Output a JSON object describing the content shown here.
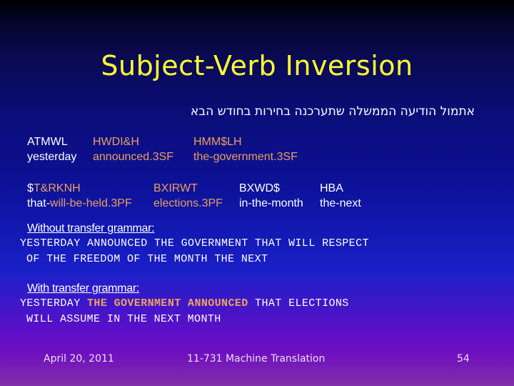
{
  "slide": {
    "title": "Subject-Verb Inversion",
    "hebrew_sentence": "אתמול הודיעה הממשלה שתערכנה בחירות בחודש הבא",
    "gloss_block_1": {
      "translit": [
        {
          "text": "ATMWL",
          "highlight": false
        },
        {
          "text": "HWDI&H",
          "highlight": true
        },
        {
          "text": "HMM$LH",
          "highlight": true
        }
      ],
      "english": [
        {
          "text": "yesterday",
          "highlight": false
        },
        {
          "text": "announced.3SF",
          "highlight": true
        },
        {
          "text": "the-government.3SF",
          "highlight": true
        }
      ]
    },
    "gloss_block_2": {
      "translit": [
        {
          "prefix": "$",
          "text": "T&RKNH",
          "highlight": true
        },
        {
          "text": "BXIRWT",
          "highlight": true
        },
        {
          "text": "BXWD$",
          "highlight": false
        },
        {
          "text": "HBA",
          "highlight": false
        }
      ],
      "english": [
        {
          "prefix": "that-",
          "text": "will-be-held.3PF",
          "highlight": true
        },
        {
          "text": "elections.3PF",
          "highlight": true
        },
        {
          "text": "in-the-month",
          "highlight": false
        },
        {
          "text": "the-next",
          "highlight": false
        }
      ]
    },
    "without_transfer": {
      "label": "Without transfer grammar:",
      "line1": "YESTERDAY ANNOUNCED THE GOVERNMENT THAT WILL RESPECT",
      "line2": "OF THE FREEDOM OF THE MONTH THE NEXT"
    },
    "with_transfer": {
      "label": "With transfer grammar:",
      "line1_pre": "YESTERDAY ",
      "line1_highlight": "THE GOVERNMENT ANNOUNCED",
      "line1_post": " THAT ELECTIONS",
      "line2": "WILL ASSUME IN THE NEXT MONTH"
    },
    "footer": {
      "date": "April 20, 2011",
      "course": "11-731 Machine Translation",
      "page": "54"
    },
    "colors": {
      "title": "#ffff33",
      "highlight": "#e8a060",
      "text": "#ffffff"
    }
  }
}
